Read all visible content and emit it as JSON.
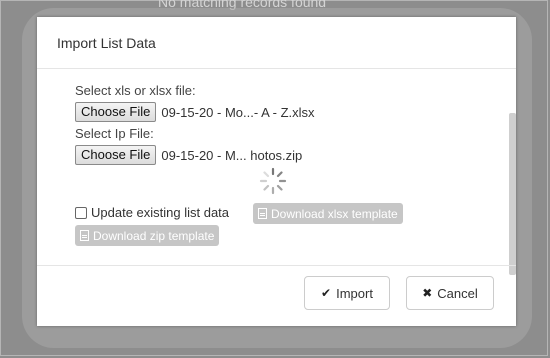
{
  "background": {
    "status_text": "No matching records found"
  },
  "modal": {
    "title": "Import List Data",
    "xls_label": "Select xls or xlsx file:",
    "xls_button": "Choose File",
    "xls_file": "09-15-20 - Mo...- A - Z.xlsx",
    "ip_label": "Select Ip File:",
    "ip_button": "Choose File",
    "ip_file": "09-15-20 - M...   hotos.zip",
    "update_label": "Update existing list data",
    "update_checked": false,
    "download_xlsx": "Download xlsx template",
    "download_zip": "Download zip template",
    "import_button": "Import",
    "cancel_button": "Cancel"
  },
  "icons": {
    "file": "file-icon",
    "check": "checkmark-icon",
    "close": "x-icon",
    "spinner": "loading-spinner-icon"
  },
  "colors": {
    "disabled_button": "#c6c6c6",
    "overlay": "#8d8d8d"
  }
}
